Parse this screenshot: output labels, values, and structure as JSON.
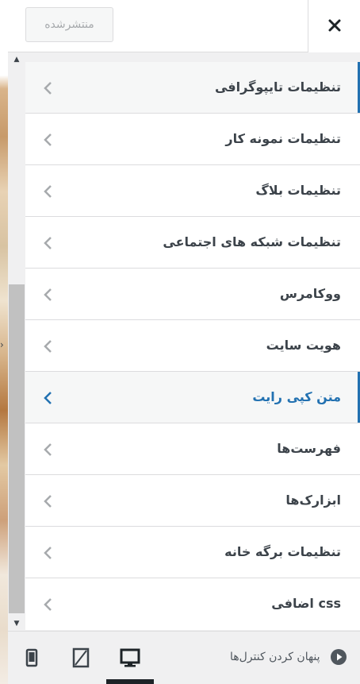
{
  "header": {
    "publish_label": "منتشرشده",
    "close_icon": "close-icon"
  },
  "menu": {
    "items": [
      {
        "label": "تنظیمات تایپوگرافی",
        "state": "active"
      },
      {
        "label": "تنظیمات نمونه کار",
        "state": "normal"
      },
      {
        "label": "تنظیمات بلاگ",
        "state": "normal"
      },
      {
        "label": "تنظیمات شبکه های اجتماعی",
        "state": "normal"
      },
      {
        "label": "ووکامرس",
        "state": "normal"
      },
      {
        "label": "هویت سایت",
        "state": "normal"
      },
      {
        "label": "متن کپی رایت",
        "state": "highlight"
      },
      {
        "label": "فهرست‌ها",
        "state": "normal"
      },
      {
        "label": "ابزارک‌ها",
        "state": "normal"
      },
      {
        "label": "تنظیمات برگه خانه",
        "state": "normal"
      },
      {
        "label": "css اضافی",
        "state": "normal"
      }
    ]
  },
  "footer": {
    "hide_controls_label": "پنهان کردن کنترل‌ها",
    "devices": [
      "desktop-icon",
      "tablet-icon",
      "mobile-icon"
    ],
    "active_device": "desktop"
  },
  "colors": {
    "accent": "#2271b1",
    "text": "#3c434a",
    "border": "#dcdcde",
    "panel_bg": "#f0f0f1"
  }
}
